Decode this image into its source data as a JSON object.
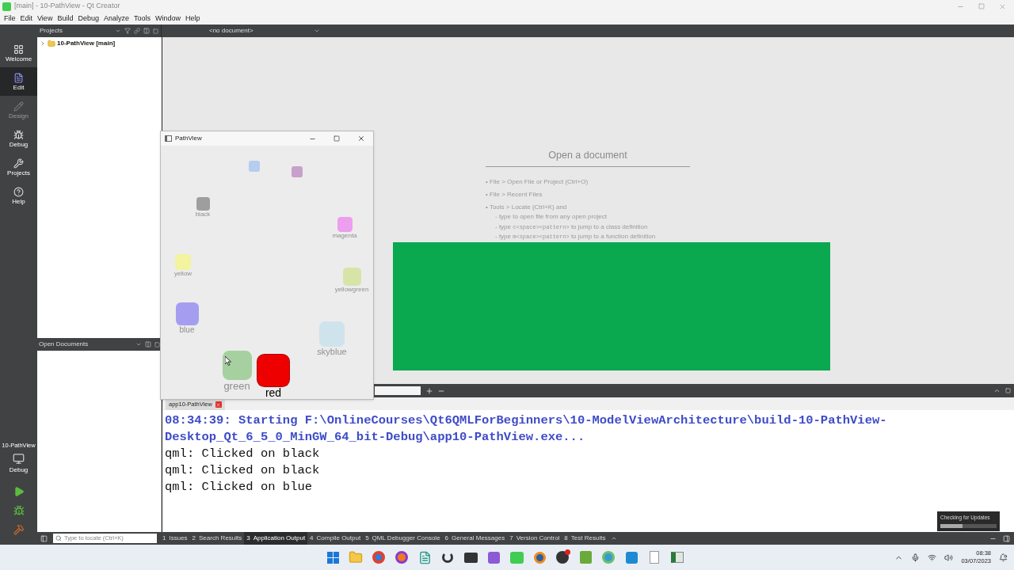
{
  "window": {
    "title": "[main] - 10-PathView - Qt Creator"
  },
  "menu": [
    "File",
    "Edit",
    "View",
    "Build",
    "Debug",
    "Analyze",
    "Tools",
    "Window",
    "Help"
  ],
  "modes": [
    {
      "kind": "welcome",
      "label": "Welcome",
      "selected": false,
      "disabled": false
    },
    {
      "kind": "edit",
      "label": "Edit",
      "selected": true,
      "disabled": false
    },
    {
      "kind": "design",
      "label": "Design",
      "selected": false,
      "disabled": true
    },
    {
      "kind": "debug",
      "label": "Debug",
      "selected": false,
      "disabled": false
    },
    {
      "kind": "projects",
      "label": "Projects",
      "selected": false,
      "disabled": false
    },
    {
      "kind": "help",
      "label": "Help",
      "selected": false,
      "disabled": false
    }
  ],
  "kit": {
    "project": "10-PathView",
    "config": "Debug"
  },
  "projects_pane": {
    "title": "Projects",
    "tree": [
      {
        "label": "10-PathView [main]",
        "expanded": false
      }
    ]
  },
  "open_documents": {
    "title": "Open Documents"
  },
  "editor": {
    "document": "<no document>",
    "open_hint": {
      "title": "Open a document",
      "lines": [
        {
          "marker": "•",
          "parts": [
            {
              "text": "File > Open File or Project (Ctrl+O)"
            }
          ]
        },
        {
          "marker": "•",
          "parts": [
            {
              "text": "File > Recent Files"
            }
          ]
        },
        {
          "marker": "•",
          "parts": [
            {
              "text": "Tools > Locate (Ctrl+K) and"
            }
          ]
        },
        {
          "marker": "-",
          "parts": [
            {
              "text": "type to open file from any open project"
            }
          ]
        },
        {
          "marker": "-",
          "parts": [
            {
              "text": "type "
            },
            {
              "text": "c<space><pattern>",
              "code": true
            },
            {
              "text": " to jump to a class definition"
            }
          ]
        },
        {
          "marker": "-",
          "parts": [
            {
              "text": "type "
            },
            {
              "text": "m<space><pattern>",
              "code": true
            },
            {
              "text": " to jump to a function definition"
            }
          ]
        }
      ]
    }
  },
  "pathview_window": {
    "title": "PathView",
    "items": [
      {
        "color": "#b5cdee",
        "current": false
      },
      {
        "color": "#c8a0cc",
        "current": false
      },
      {
        "label": "black",
        "color": "#9e9e9e",
        "current": false
      },
      {
        "label": "magenta",
        "color": "#ee9eee",
        "current": false
      },
      {
        "label": "yellow",
        "color": "#f3f3a0",
        "current": false
      },
      {
        "label": "yellowgreen",
        "color": "#d7e4a8",
        "current": false
      },
      {
        "label": "blue",
        "color": "#a59ef0",
        "current": false
      },
      {
        "label": "skyblue",
        "color": "#cfe3ed",
        "current": false
      },
      {
        "label": "green",
        "color": "#a6d0a0",
        "current": false
      },
      {
        "label": "red",
        "color": "#ee0000",
        "current": true
      }
    ]
  },
  "output": {
    "tab": "app10-PathView",
    "lines": [
      {
        "kind": "status",
        "text": "08:34:39: Starting F:\\OnlineCourses\\Qt6QMLForBeginners\\10-ModelViewArchitecture\\build-10-PathView-"
      },
      {
        "kind": "status",
        "text": "Desktop_Qt_6_5_0_MinGW_64_bit-Debug\\app10-PathView.exe..."
      },
      {
        "kind": "log",
        "text": "qml: Clicked on black"
      },
      {
        "kind": "log",
        "text": "qml: Clicked on black"
      },
      {
        "kind": "log",
        "text": "qml: Clicked on blue"
      }
    ]
  },
  "status_bar": {
    "locate_placeholder": "Type to locate (Ctrl+K)",
    "panes": [
      {
        "number": "1",
        "label": "Issues",
        "selected": false
      },
      {
        "number": "2",
        "label": "Search Results",
        "selected": false
      },
      {
        "number": "3",
        "label": "Application Output",
        "selected": true
      },
      {
        "number": "4",
        "label": "Compile Output",
        "selected": false
      },
      {
        "number": "5",
        "label": "QML Debugger Console",
        "selected": false
      },
      {
        "number": "6",
        "label": "General Messages",
        "selected": false
      },
      {
        "number": "7",
        "label": "Version Control",
        "selected": false
      },
      {
        "number": "8",
        "label": "Test Results",
        "selected": false
      }
    ]
  },
  "update_popup": {
    "title": "Checking for Updates",
    "level": 0.4
  },
  "taskbar": {
    "time": "08:38",
    "date": "03/07/2023"
  }
}
